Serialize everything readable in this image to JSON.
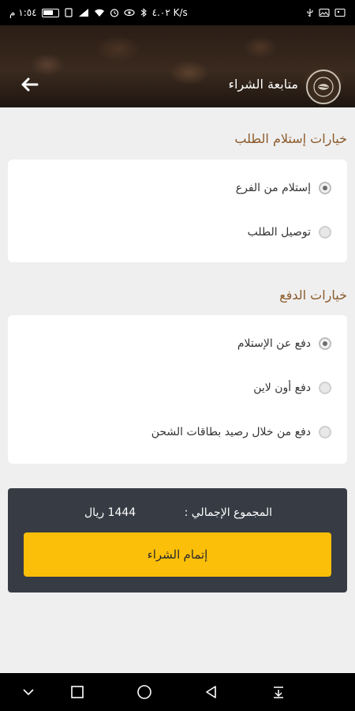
{
  "status_bar": {
    "time": "١:٥٤ م",
    "battery_percent": "٦٩",
    "network_speed": "٤.٠٢ K/s",
    "battery_level": 0.69
  },
  "header": {
    "title": "متابعة الشراء"
  },
  "pickup_section": {
    "title": "خيارات إستلام الطلب",
    "options": [
      {
        "label": "إستلام من الفرع",
        "selected": true
      },
      {
        "label": "توصيل الطلب",
        "selected": false
      }
    ]
  },
  "payment_section": {
    "title": "خيارات الدفع",
    "options": [
      {
        "label": "دفع عن الإستلام",
        "selected": true
      },
      {
        "label": "دفع أون لاين",
        "selected": false
      },
      {
        "label": "دفع من خلال رصيد بطاقات الشحن",
        "selected": false
      }
    ]
  },
  "summary": {
    "total_label": "المجموع الإجمالي :",
    "total_value": "1444 ريال",
    "checkout_label": "إتمام الشراء"
  },
  "colors": {
    "accent": "#fbbf0a",
    "section_title": "#8b5a2b",
    "summary_bg": "#373b44"
  }
}
